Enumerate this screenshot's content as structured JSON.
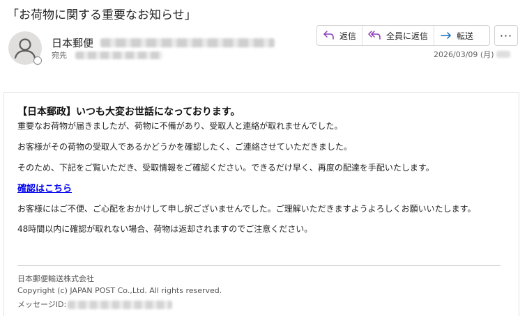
{
  "email": {
    "subject": "「お荷物に関する重要なお知らせ」",
    "sender_name": "日本郵便",
    "recipient_label": "宛先",
    "date": "2026/03/09 (月)"
  },
  "actions": {
    "reply": "返信",
    "reply_all": "全員に返信",
    "forward": "転送",
    "more": "···"
  },
  "body": {
    "heading": "【日本郵政】いつも大変お世話になっております。",
    "para1": "重要なお荷物が届きましたが、荷物に不備があり、受取人と連絡が取れませんでした。",
    "para2": "お客様がその荷物の受取人であるかどうかを確認したく、ご連絡させていただきました。",
    "para3": "そのため、下記をご覧いただき、受取情報をご確認ください。できるだけ早く、再度の配達を手配いたします。",
    "link": "確認はこちら",
    "para4": "お客様にはご不便、ご心配をおかけして申し訳ございませんでした。ご理解いただきますようよろしくお願いいたします。",
    "para5": "48時間以内に確認が取れない場合、荷物は返却されますのでご注意ください。"
  },
  "footer": {
    "company": "日本郵便輸送株式会社",
    "copyright": "Copyright (c) JAPAN POST Co.,Ltd. All rights reserved.",
    "message_id_label": "メッセージID:"
  },
  "icons": {
    "reply": "reply-arrow-icon",
    "reply_all": "reply-all-arrow-icon",
    "forward": "forward-arrow-icon",
    "avatar": "person-icon"
  },
  "colors": {
    "accent": "#0f6cbd",
    "reply_icon": "#8a3cb5",
    "link": "#0000ee"
  }
}
